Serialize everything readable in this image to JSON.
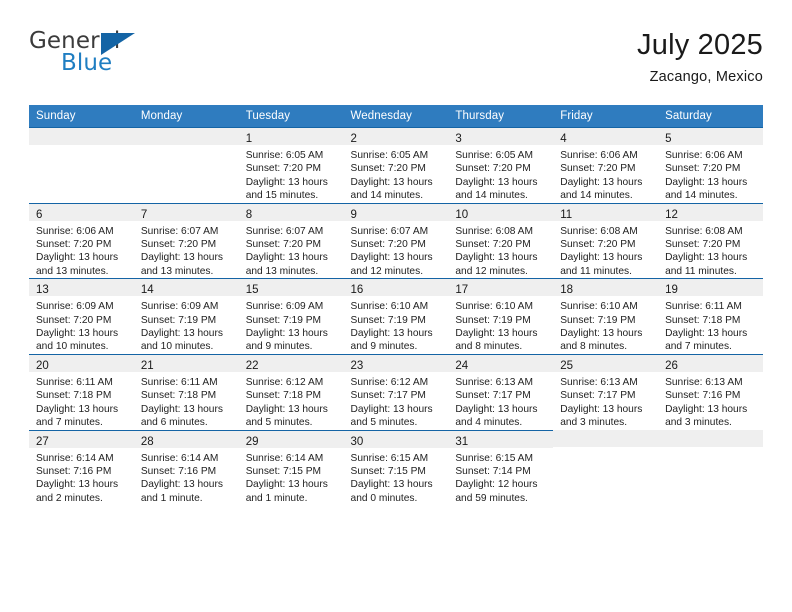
{
  "brand": {
    "name_top": "General",
    "name_bottom": "Blue",
    "accent_color": "#1464a5",
    "blue_text_color": "#1f7ec2"
  },
  "header": {
    "title": "July 2025",
    "subtitle": "Zacango, Mexico"
  },
  "theme": {
    "header_blue": "#2f7cbf",
    "border_blue": "#1464a5",
    "daynum_band": "#efefef"
  },
  "weekday_headers": [
    "Sunday",
    "Monday",
    "Tuesday",
    "Wednesday",
    "Thursday",
    "Friday",
    "Saturday"
  ],
  "weeks": [
    [
      {
        "day": "",
        "sunrise": "",
        "sunset": "",
        "daylight_1": "",
        "daylight_2": ""
      },
      {
        "day": "",
        "sunrise": "",
        "sunset": "",
        "daylight_1": "",
        "daylight_2": ""
      },
      {
        "day": "1",
        "sunrise": "Sunrise: 6:05 AM",
        "sunset": "Sunset: 7:20 PM",
        "daylight_1": "Daylight: 13 hours",
        "daylight_2": "and 15 minutes."
      },
      {
        "day": "2",
        "sunrise": "Sunrise: 6:05 AM",
        "sunset": "Sunset: 7:20 PM",
        "daylight_1": "Daylight: 13 hours",
        "daylight_2": "and 14 minutes."
      },
      {
        "day": "3",
        "sunrise": "Sunrise: 6:05 AM",
        "sunset": "Sunset: 7:20 PM",
        "daylight_1": "Daylight: 13 hours",
        "daylight_2": "and 14 minutes."
      },
      {
        "day": "4",
        "sunrise": "Sunrise: 6:06 AM",
        "sunset": "Sunset: 7:20 PM",
        "daylight_1": "Daylight: 13 hours",
        "daylight_2": "and 14 minutes."
      },
      {
        "day": "5",
        "sunrise": "Sunrise: 6:06 AM",
        "sunset": "Sunset: 7:20 PM",
        "daylight_1": "Daylight: 13 hours",
        "daylight_2": "and 14 minutes."
      }
    ],
    [
      {
        "day": "6",
        "sunrise": "Sunrise: 6:06 AM",
        "sunset": "Sunset: 7:20 PM",
        "daylight_1": "Daylight: 13 hours",
        "daylight_2": "and 13 minutes."
      },
      {
        "day": "7",
        "sunrise": "Sunrise: 6:07 AM",
        "sunset": "Sunset: 7:20 PM",
        "daylight_1": "Daylight: 13 hours",
        "daylight_2": "and 13 minutes."
      },
      {
        "day": "8",
        "sunrise": "Sunrise: 6:07 AM",
        "sunset": "Sunset: 7:20 PM",
        "daylight_1": "Daylight: 13 hours",
        "daylight_2": "and 13 minutes."
      },
      {
        "day": "9",
        "sunrise": "Sunrise: 6:07 AM",
        "sunset": "Sunset: 7:20 PM",
        "daylight_1": "Daylight: 13 hours",
        "daylight_2": "and 12 minutes."
      },
      {
        "day": "10",
        "sunrise": "Sunrise: 6:08 AM",
        "sunset": "Sunset: 7:20 PM",
        "daylight_1": "Daylight: 13 hours",
        "daylight_2": "and 12 minutes."
      },
      {
        "day": "11",
        "sunrise": "Sunrise: 6:08 AM",
        "sunset": "Sunset: 7:20 PM",
        "daylight_1": "Daylight: 13 hours",
        "daylight_2": "and 11 minutes."
      },
      {
        "day": "12",
        "sunrise": "Sunrise: 6:08 AM",
        "sunset": "Sunset: 7:20 PM",
        "daylight_1": "Daylight: 13 hours",
        "daylight_2": "and 11 minutes."
      }
    ],
    [
      {
        "day": "13",
        "sunrise": "Sunrise: 6:09 AM",
        "sunset": "Sunset: 7:20 PM",
        "daylight_1": "Daylight: 13 hours",
        "daylight_2": "and 10 minutes."
      },
      {
        "day": "14",
        "sunrise": "Sunrise: 6:09 AM",
        "sunset": "Sunset: 7:19 PM",
        "daylight_1": "Daylight: 13 hours",
        "daylight_2": "and 10 minutes."
      },
      {
        "day": "15",
        "sunrise": "Sunrise: 6:09 AM",
        "sunset": "Sunset: 7:19 PM",
        "daylight_1": "Daylight: 13 hours",
        "daylight_2": "and 9 minutes."
      },
      {
        "day": "16",
        "sunrise": "Sunrise: 6:10 AM",
        "sunset": "Sunset: 7:19 PM",
        "daylight_1": "Daylight: 13 hours",
        "daylight_2": "and 9 minutes."
      },
      {
        "day": "17",
        "sunrise": "Sunrise: 6:10 AM",
        "sunset": "Sunset: 7:19 PM",
        "daylight_1": "Daylight: 13 hours",
        "daylight_2": "and 8 minutes."
      },
      {
        "day": "18",
        "sunrise": "Sunrise: 6:10 AM",
        "sunset": "Sunset: 7:19 PM",
        "daylight_1": "Daylight: 13 hours",
        "daylight_2": "and 8 minutes."
      },
      {
        "day": "19",
        "sunrise": "Sunrise: 6:11 AM",
        "sunset": "Sunset: 7:18 PM",
        "daylight_1": "Daylight: 13 hours",
        "daylight_2": "and 7 minutes."
      }
    ],
    [
      {
        "day": "20",
        "sunrise": "Sunrise: 6:11 AM",
        "sunset": "Sunset: 7:18 PM",
        "daylight_1": "Daylight: 13 hours",
        "daylight_2": "and 7 minutes."
      },
      {
        "day": "21",
        "sunrise": "Sunrise: 6:11 AM",
        "sunset": "Sunset: 7:18 PM",
        "daylight_1": "Daylight: 13 hours",
        "daylight_2": "and 6 minutes."
      },
      {
        "day": "22",
        "sunrise": "Sunrise: 6:12 AM",
        "sunset": "Sunset: 7:18 PM",
        "daylight_1": "Daylight: 13 hours",
        "daylight_2": "and 5 minutes."
      },
      {
        "day": "23",
        "sunrise": "Sunrise: 6:12 AM",
        "sunset": "Sunset: 7:17 PM",
        "daylight_1": "Daylight: 13 hours",
        "daylight_2": "and 5 minutes."
      },
      {
        "day": "24",
        "sunrise": "Sunrise: 6:13 AM",
        "sunset": "Sunset: 7:17 PM",
        "daylight_1": "Daylight: 13 hours",
        "daylight_2": "and 4 minutes."
      },
      {
        "day": "25",
        "sunrise": "Sunrise: 6:13 AM",
        "sunset": "Sunset: 7:17 PM",
        "daylight_1": "Daylight: 13 hours",
        "daylight_2": "and 3 minutes."
      },
      {
        "day": "26",
        "sunrise": "Sunrise: 6:13 AM",
        "sunset": "Sunset: 7:16 PM",
        "daylight_1": "Daylight: 13 hours",
        "daylight_2": "and 3 minutes."
      }
    ],
    [
      {
        "day": "27",
        "sunrise": "Sunrise: 6:14 AM",
        "sunset": "Sunset: 7:16 PM",
        "daylight_1": "Daylight: 13 hours",
        "daylight_2": "and 2 minutes."
      },
      {
        "day": "28",
        "sunrise": "Sunrise: 6:14 AM",
        "sunset": "Sunset: 7:16 PM",
        "daylight_1": "Daylight: 13 hours",
        "daylight_2": "and 1 minute."
      },
      {
        "day": "29",
        "sunrise": "Sunrise: 6:14 AM",
        "sunset": "Sunset: 7:15 PM",
        "daylight_1": "Daylight: 13 hours",
        "daylight_2": "and 1 minute."
      },
      {
        "day": "30",
        "sunrise": "Sunrise: 6:15 AM",
        "sunset": "Sunset: 7:15 PM",
        "daylight_1": "Daylight: 13 hours",
        "daylight_2": "and 0 minutes."
      },
      {
        "day": "31",
        "sunrise": "Sunrise: 6:15 AM",
        "sunset": "Sunset: 7:14 PM",
        "daylight_1": "Daylight: 12 hours",
        "daylight_2": "and 59 minutes."
      },
      {
        "day": "",
        "sunrise": "",
        "sunset": "",
        "daylight_1": "",
        "daylight_2": ""
      },
      {
        "day": "",
        "sunrise": "",
        "sunset": "",
        "daylight_1": "",
        "daylight_2": ""
      }
    ]
  ]
}
